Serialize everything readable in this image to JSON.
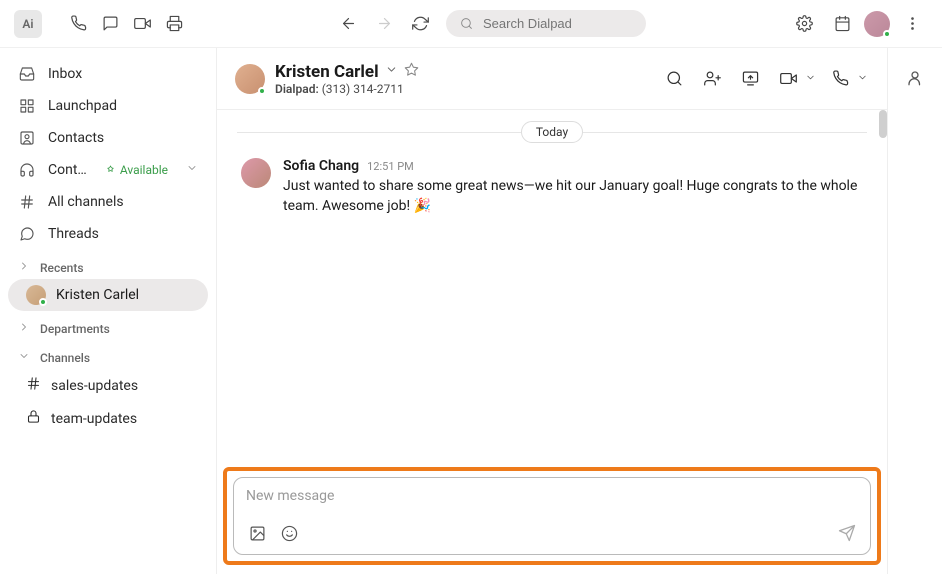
{
  "search": {
    "placeholder": "Search Dialpad"
  },
  "sidebar": {
    "inbox": "Inbox",
    "launchpad": "Launchpad",
    "contacts": "Contacts",
    "cont_label": "Cont…",
    "cont_status": "Available",
    "all_channels": "All channels",
    "threads": "Threads",
    "recents_label": "Recents",
    "recent_name": "Kristen Carlel",
    "departments_label": "Departments",
    "channels_label": "Channels",
    "channel1": "sales-updates",
    "channel2": "team-updates"
  },
  "header": {
    "name": "Kristen Carlel",
    "source_label": "Dialpad:",
    "phone": "(313) 314-2711"
  },
  "thread": {
    "date_label": "Today",
    "msg1": {
      "author": "Sofia Chang",
      "time": "12:51 PM",
      "text": "Just wanted to share some great news—we hit our January goal! Huge congrats to the whole team. Awesome job! 🎉"
    }
  },
  "composer": {
    "placeholder": "New message"
  }
}
